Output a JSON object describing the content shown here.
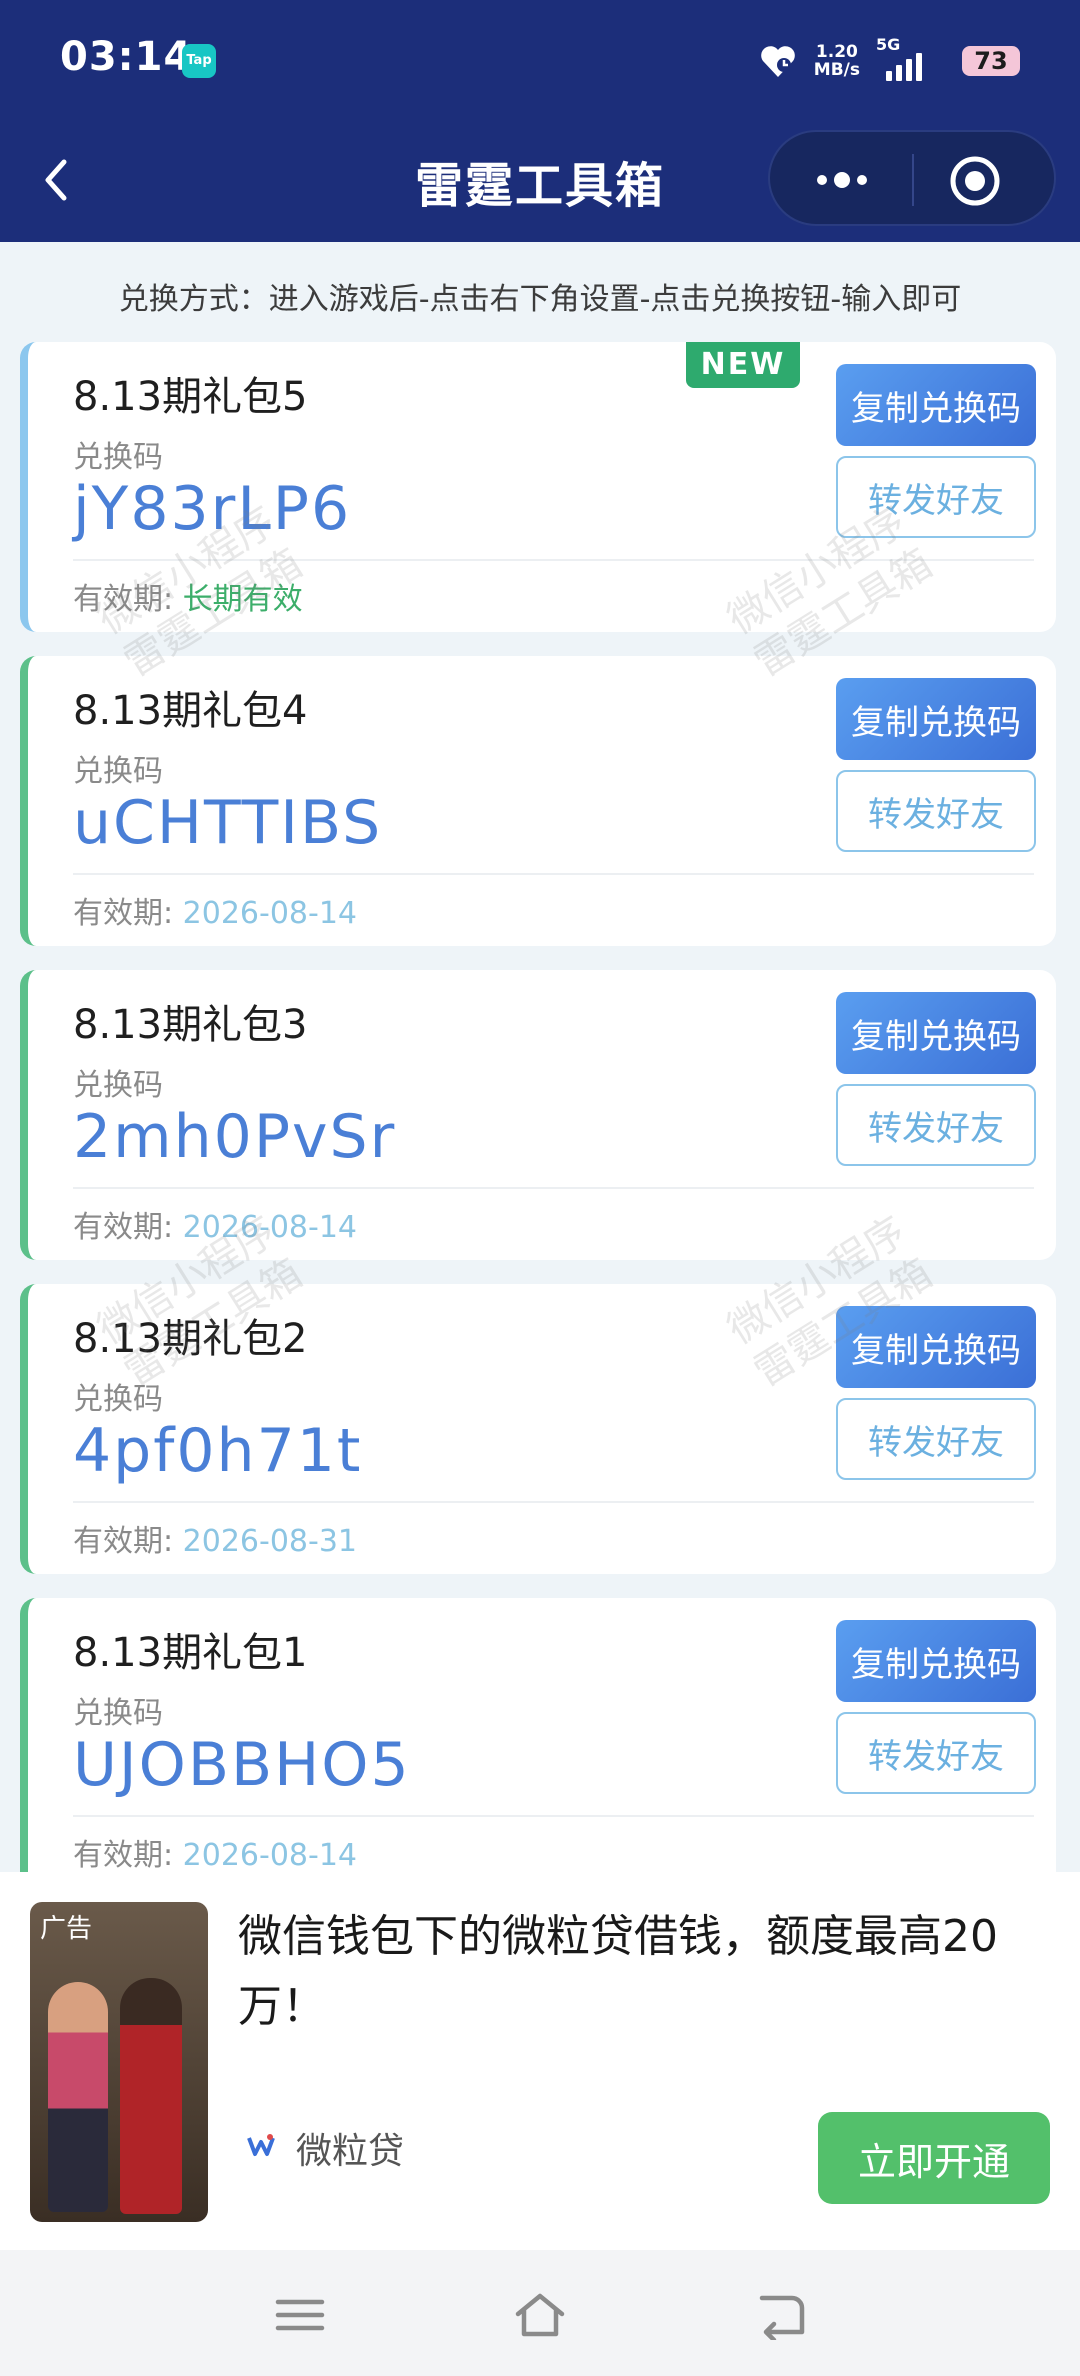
{
  "status": {
    "time": "03:14",
    "tap_badge": "Tap",
    "net_speed_value": "1.20",
    "net_speed_unit": "MB/s",
    "network": "5G",
    "battery": "73"
  },
  "header": {
    "title": "雷霆工具箱"
  },
  "hint": "兑换方式：进入游戏后-点击右下角设置-点击兑换按钮-输入即可",
  "common": {
    "code_label": "兑换码",
    "expiry_label": "有效期:",
    "copy_button": "复制兑换码",
    "share_button": "转发好友",
    "new_badge": "NEW"
  },
  "cards": [
    {
      "title": "8.13期礼包5",
      "code": "jY83rLP6",
      "expiry": "长期有效"
    },
    {
      "title": "8.13期礼包4",
      "code": "uCHTTIBS",
      "expiry": "2026-08-14"
    },
    {
      "title": "8.13期礼包3",
      "code": "2mh0PvSr",
      "expiry": "2026-08-14"
    },
    {
      "title": "8.13期礼包2",
      "code": "4pf0h71t",
      "expiry": "2026-08-31"
    },
    {
      "title": "8.13期礼包1",
      "code": "UJOBBHO5",
      "expiry": "2026-08-14"
    }
  ],
  "watermark": {
    "line1": "微信小程序",
    "line2": "雷霆工具箱"
  },
  "ad": {
    "label": "广告",
    "title": "微信钱包下的微粒贷借钱，额度最高20万！",
    "brand": "微粒贷",
    "button": "立即开通"
  }
}
